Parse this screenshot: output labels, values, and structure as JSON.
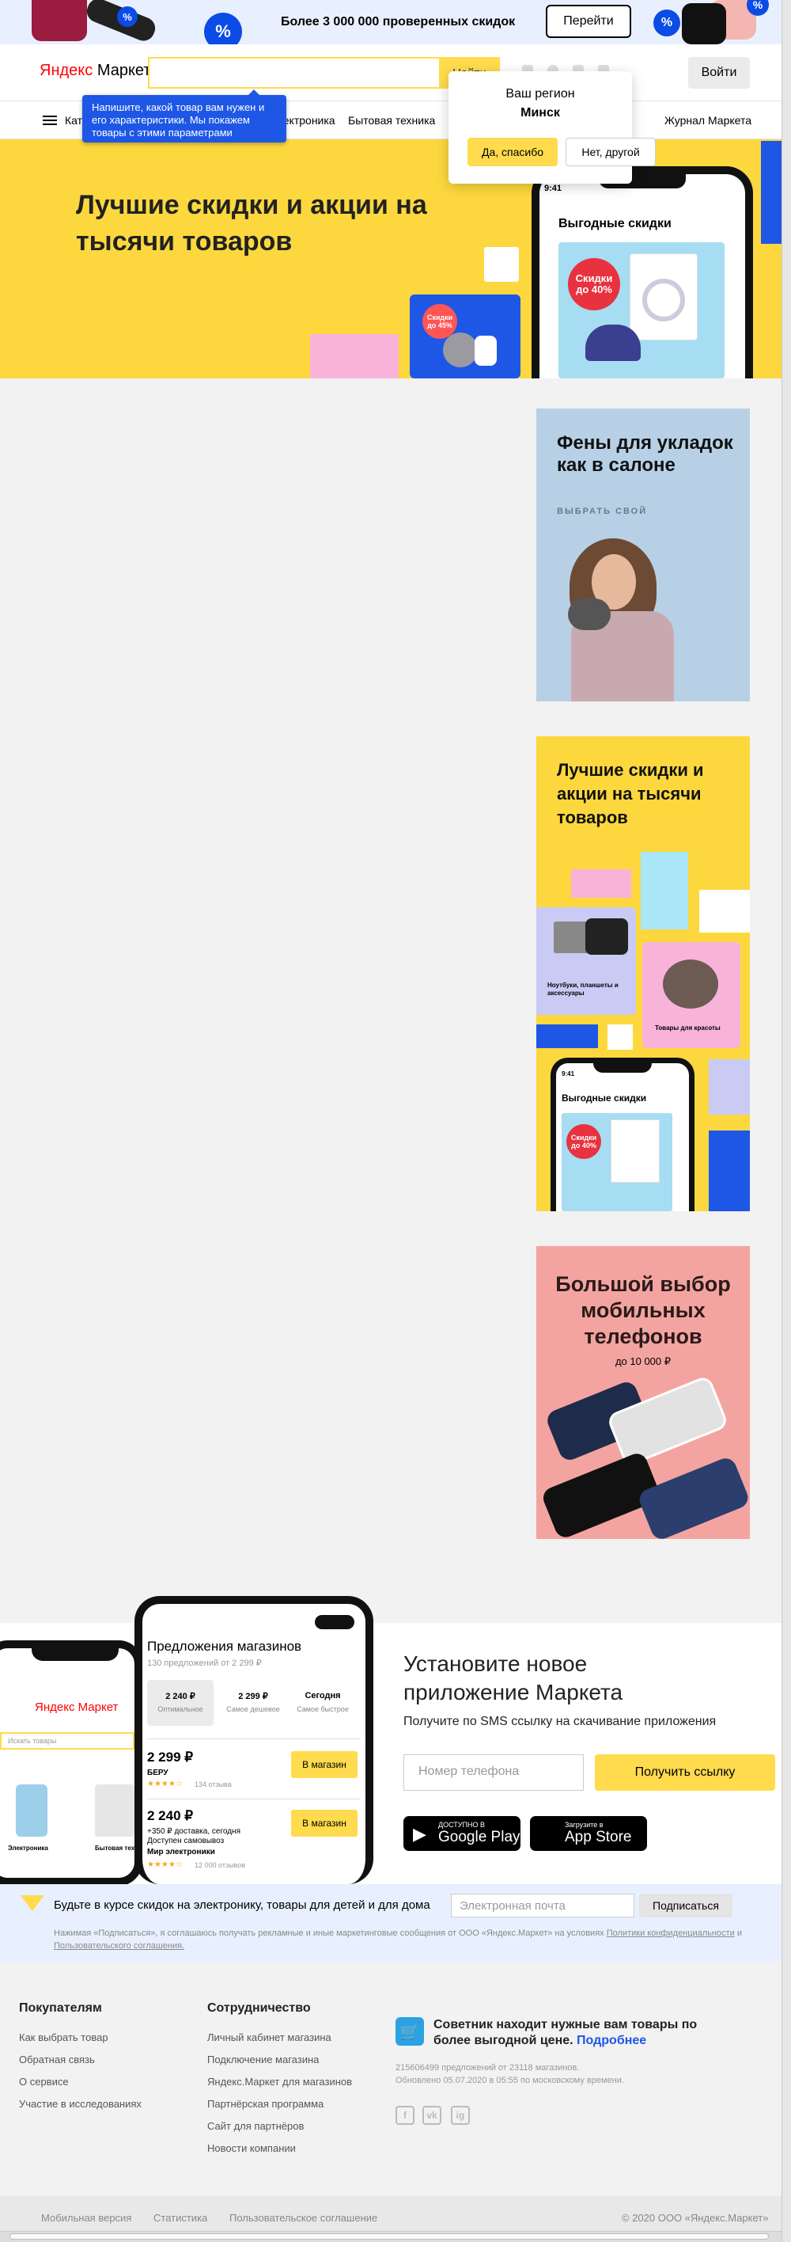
{
  "promo": {
    "text": "Более 3 000 000 проверенных скидок",
    "button": "Перейти",
    "pct": "%"
  },
  "header": {
    "logo_brand": "Яндекс",
    "logo_product": "Маркет",
    "search_button": "Найти",
    "login": "Войти"
  },
  "nav": {
    "items": [
      "Каталог",
      "Электроника",
      "Бытовая техника",
      "Журнал Маркета"
    ]
  },
  "tooltip": {
    "text": "Напишите, какой товар вам нужен и его характеристики. Мы покажем товары с этими параметрами"
  },
  "region": {
    "question": "Ваш регион",
    "city": "Минск",
    "yes": "Да, спасибо",
    "no": "Нет, другой"
  },
  "hero": {
    "title": "Лучшие скидки и акции на тысячи товаров",
    "phone_time": "9:41",
    "phone_title": "Выгодные скидки",
    "badge1": "Скидки до 40%",
    "badge2": "Скидки до 45%"
  },
  "banners": {
    "b1_title": "Фены для укладок как в салоне",
    "b1_sub": "ВЫБРАТЬ СВОЙ",
    "b2_title": "Лучшие скидки и акции на тысячи товаров",
    "b2_card1": "Ноутбуки, планшеты и аксессуары",
    "b2_card2": "Товары для красоты",
    "b2_phone_title": "Выгодные скидки",
    "b2_time": "9:41",
    "b3_title": "Большой выбор мобильных телефонов",
    "b3_sub": "до 10 000 ₽"
  },
  "app_mock": {
    "title": "Предложения магазинов",
    "subtitle": "130 предложений от 2 299 ₽",
    "tabs": [
      {
        "price": "2 240 ₽",
        "label": "Оптимальное"
      },
      {
        "price": "2 299 ₽",
        "label": "Самое дешевое"
      },
      {
        "price": "Сегодня",
        "label": "Самое быстрое"
      }
    ],
    "offers": [
      {
        "price": "2 299 ₽",
        "shop": "БЕРУ",
        "reviews": "134 отзыва",
        "button": "В магазин",
        "delivery": ""
      },
      {
        "price": "2 240 ₽",
        "shop": "Мир электроники",
        "reviews": "12 000 отзывов",
        "button": "В магазин",
        "delivery": "+350 ₽ доставка, сегодня"
      }
    ],
    "pickup": "Доступен самовывоз",
    "left_logo": "Яндекс Маркет",
    "left_search": "Искать товары",
    "left_cat1": "Электроника",
    "left_cat2": "Бытовая техн"
  },
  "app": {
    "title": "Установите новое приложение Маркета",
    "subtitle": "Получите по SMS ссылку на скачивание приложения",
    "phone_placeholder": "Номер телефона",
    "get_link": "Получить ссылку",
    "google_small": "ДОСТУПНО В",
    "google_big": "Google Play",
    "apple_small": "Загрузите в",
    "apple_big": "App Store"
  },
  "subscribe": {
    "text": "Будьте в курсе скидок на электронику, товары для детей и для дома",
    "email_placeholder": "Электронная почта",
    "button": "Подписаться",
    "fine_1": "Нажимая «Подписаться», я соглашаюсь получать рекламные и иные маркетинговые сообщения от ООО «Яндекс.Маркет» на условиях",
    "fine_link1": "Политики конфиденциальности",
    "fine_and": "и",
    "fine_link2": "Пользовательского соглашения."
  },
  "footer": {
    "col1_title": "Покупателям",
    "col1": [
      "Как выбрать товар",
      "Обратная связь",
      "О сервисе",
      "Участие в исследованиях"
    ],
    "col2_title": "Сотрудничество",
    "col2": [
      "Личный кабинет магазина",
      "Подключение магазина",
      "Яндекс.Маркет для магазинов",
      "Партнёрская программа",
      "Сайт для партнёров",
      "Новости компании"
    ],
    "advisor_text": "Советник находит нужные вам товары по более выгодной цене.",
    "advisor_link": "Подробнее",
    "stats_1": "215606499 предложений от 23118 магазинов.",
    "stats_2": "Обновлено 05.07.2020 в 05:55 по московскому времени.",
    "social": [
      "f",
      "vk",
      "ig"
    ]
  },
  "bottom": {
    "links": [
      "Мобильная версия",
      "Статистика",
      "Пользовательское соглашение"
    ],
    "copyright": "© 2020  ООО «Яндекс.Маркет»"
  },
  "colors": {
    "yellow": "#fcd83e",
    "button_yellow": "#ffdb4d",
    "blue": "#1e57e6",
    "light_blue": "#e8f0ff"
  }
}
